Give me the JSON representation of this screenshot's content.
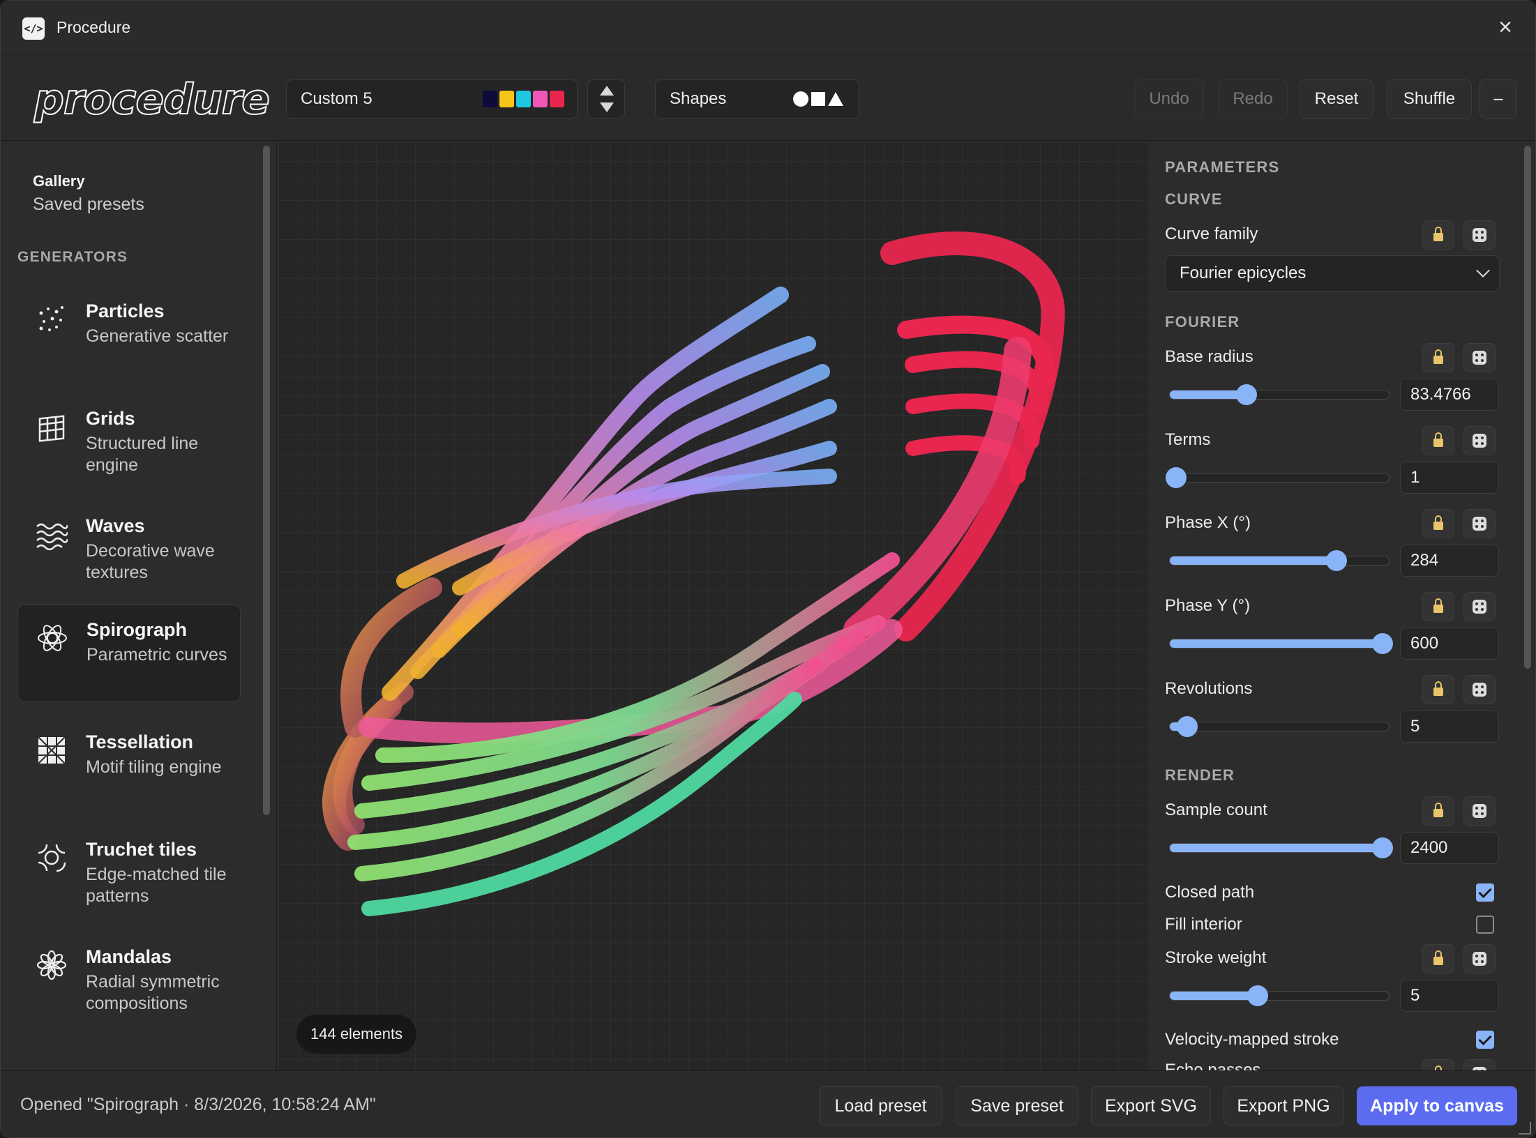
{
  "window": {
    "title": "Procedure",
    "icon_text": "</>"
  },
  "toolbar": {
    "logo": "procedure",
    "preset": {
      "label": "Custom 5",
      "swatches": [
        "#0d0b3a",
        "#f5c518",
        "#1ec8e0",
        "#f055b8",
        "#e8264e"
      ]
    },
    "shapes_label": "Shapes",
    "undo": "Undo",
    "redo": "Redo",
    "reset": "Reset",
    "shuffle": "Shuffle",
    "collapse": "–"
  },
  "sidebar": {
    "gallery_title": "Gallery",
    "gallery_sub": "Saved presets",
    "section": "GENERATORS",
    "items": [
      {
        "name": "Particles",
        "desc": "Generative scatter",
        "icon": "particles-icon"
      },
      {
        "name": "Grids",
        "desc": "Structured line engine",
        "icon": "grid-icon"
      },
      {
        "name": "Waves",
        "desc": "Decorative wave textures",
        "icon": "waves-icon"
      },
      {
        "name": "Spirograph",
        "desc": "Parametric curves",
        "icon": "spirograph-icon",
        "active": true
      },
      {
        "name": "Tessellation",
        "desc": "Motif tiling engine",
        "icon": "tessellation-icon"
      },
      {
        "name": "Truchet tiles",
        "desc": "Edge-matched tile patterns",
        "icon": "truchet-icon"
      },
      {
        "name": "Mandalas",
        "desc": "Radial symmetric compositions",
        "icon": "mandala-icon"
      }
    ]
  },
  "canvas": {
    "element_count": "144 elements"
  },
  "params": {
    "title": "PARAMETERS",
    "curve_section": "CURVE",
    "curve_family_label": "Curve family",
    "curve_family_value": "Fourier epicycles",
    "fourier_section": "FOURIER",
    "base_radius": {
      "label": "Base radius",
      "value": "83.4766",
      "level": 0.35
    },
    "terms": {
      "label": "Terms",
      "value": "1",
      "level": 0.03
    },
    "phase_x": {
      "label": "Phase X (°)",
      "value": "284",
      "level": 0.76
    },
    "phase_y": {
      "label": "Phase Y (°)",
      "value": "600",
      "level": 0.97
    },
    "revolutions": {
      "label": "Revolutions",
      "value": "5",
      "level": 0.08
    },
    "render_section": "RENDER",
    "sample_count": {
      "label": "Sample count",
      "value": "2400",
      "level": 0.97
    },
    "closed_path": {
      "label": "Closed path",
      "checked": true
    },
    "fill_interior": {
      "label": "Fill interior",
      "checked": false
    },
    "stroke_weight": {
      "label": "Stroke weight",
      "value": "5",
      "level": 0.4
    },
    "velocity_stroke": {
      "label": "Velocity-mapped stroke",
      "checked": true
    },
    "next_label": "Echo passes"
  },
  "footer": {
    "status": "Opened \"Spirograph · 8/3/2026, 10:58:24 AM\"",
    "load": "Load preset",
    "save": "Save preset",
    "export_svg": "Export SVG",
    "export_png": "Export PNG",
    "apply": "Apply to canvas"
  },
  "colors": {
    "accent": "#8ab4f8",
    "primary_button": "#5b6cf0"
  }
}
